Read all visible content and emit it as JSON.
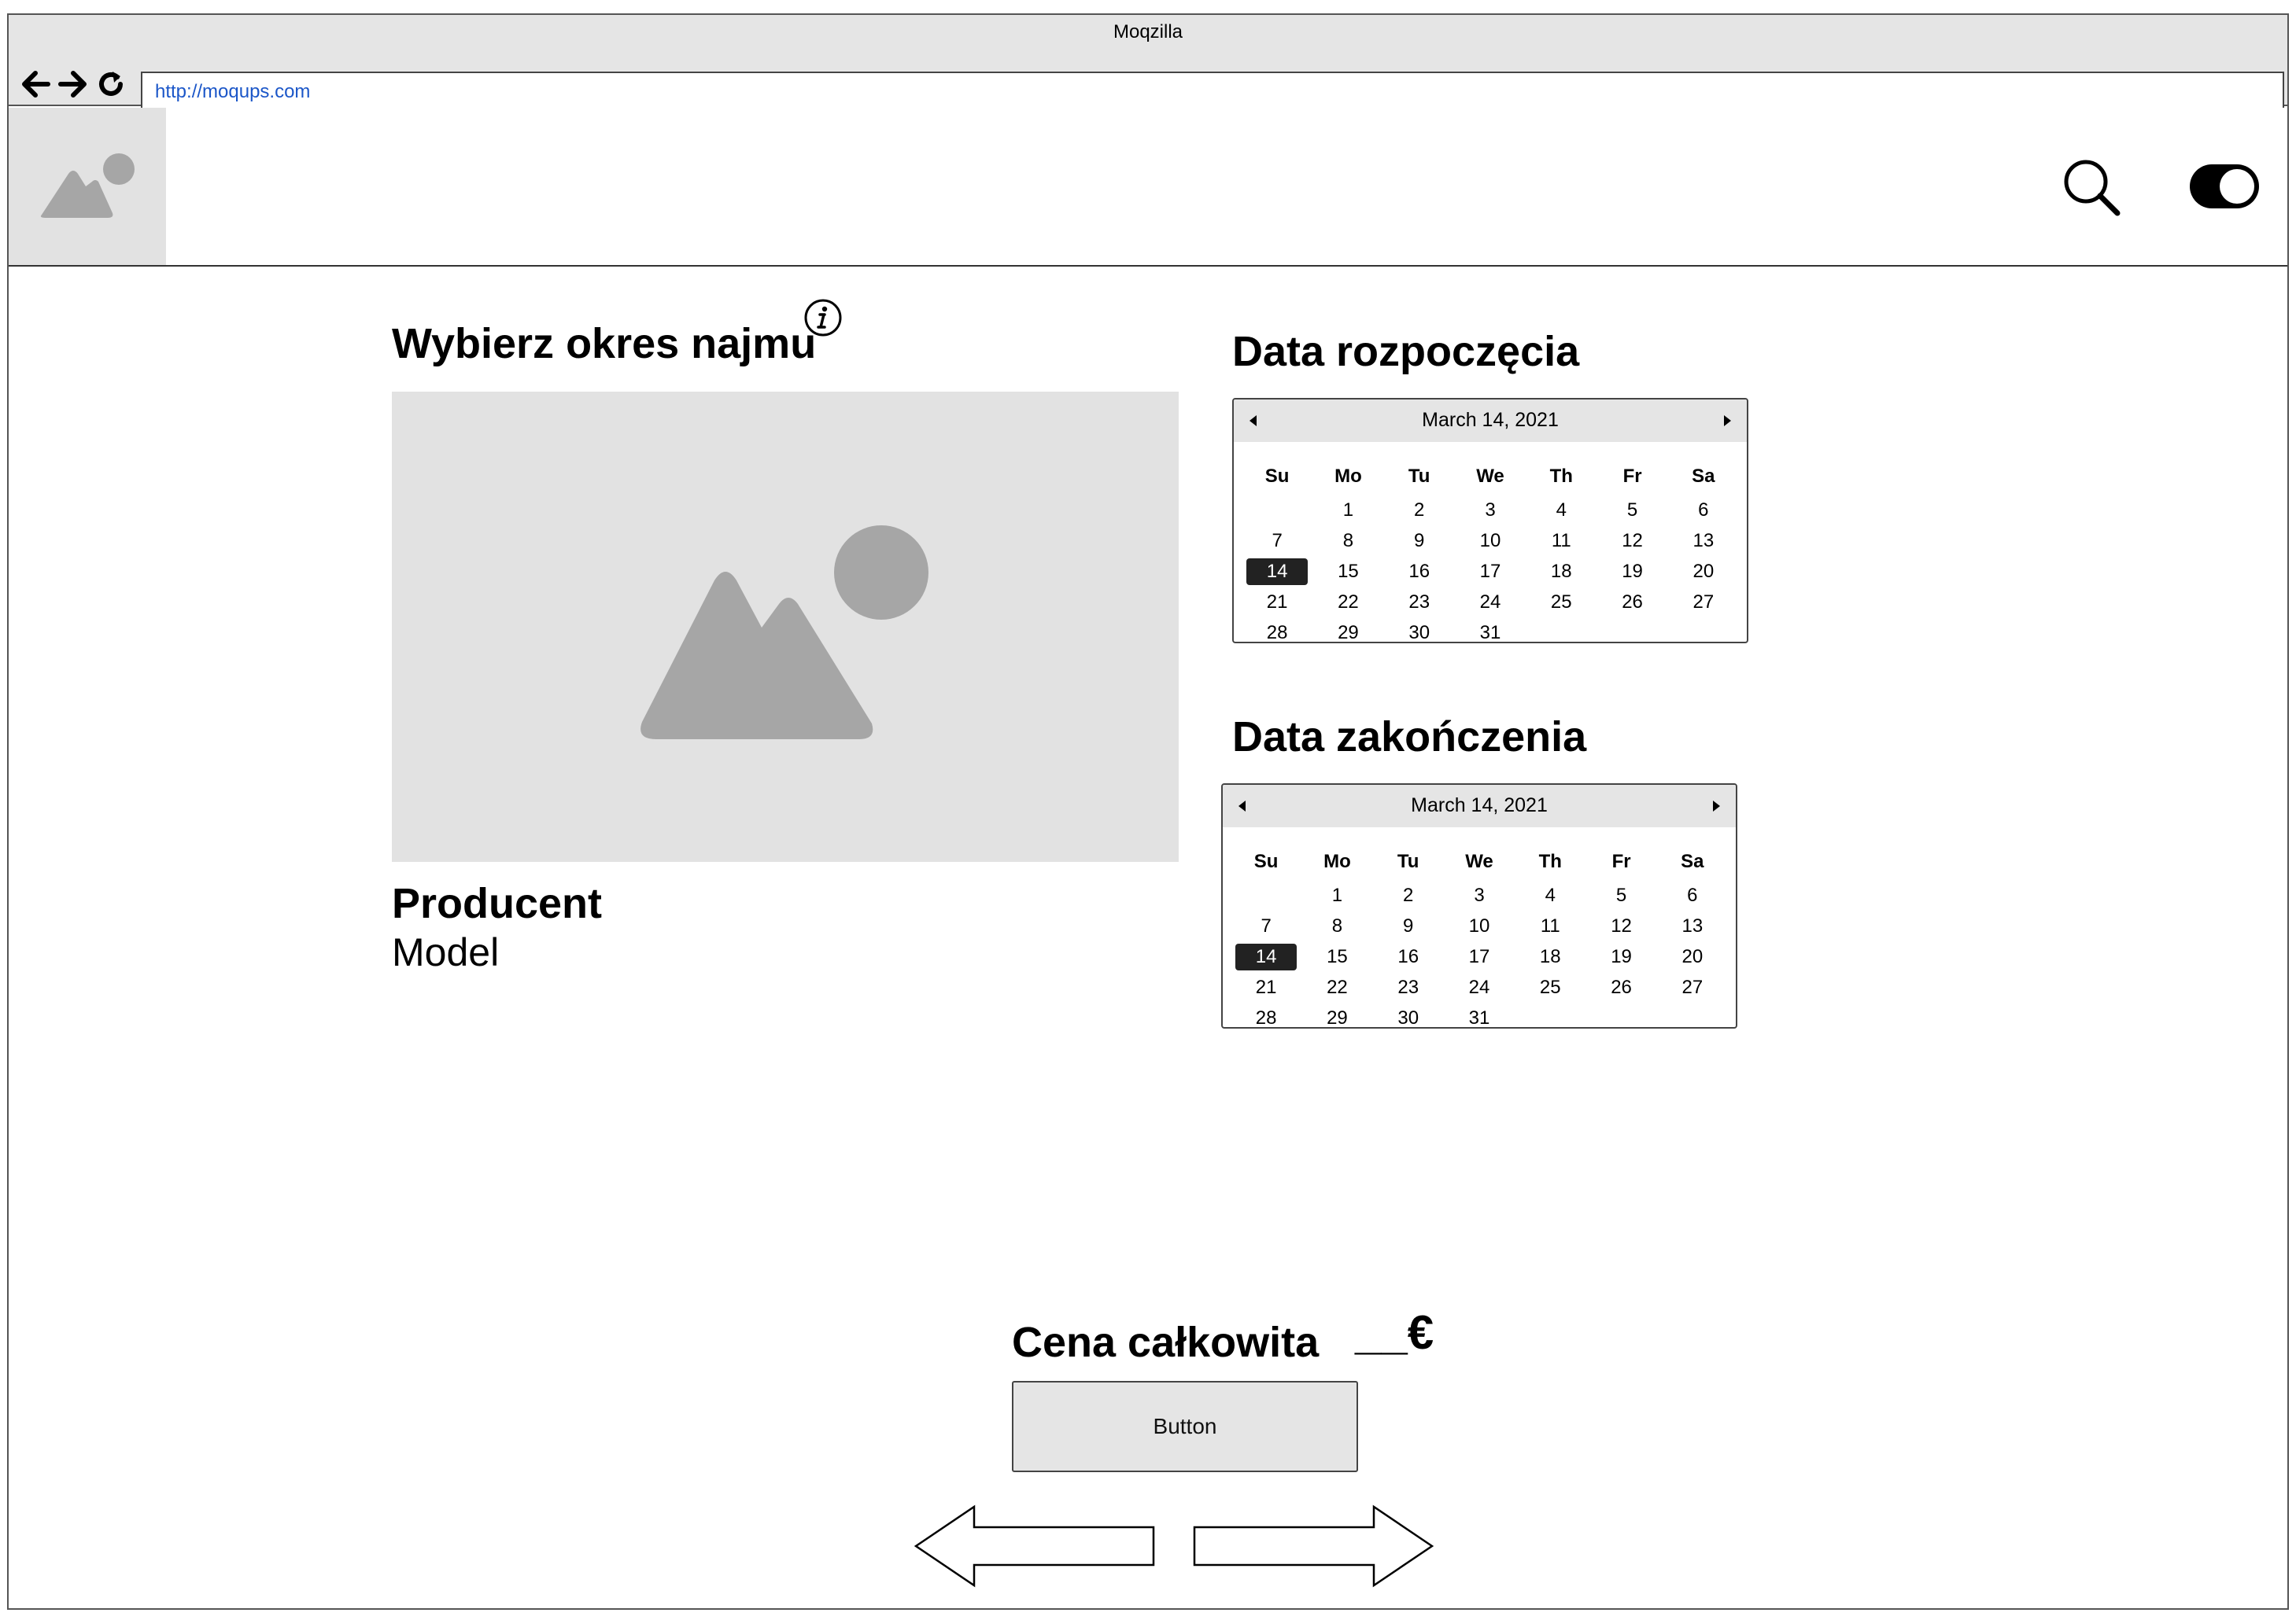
{
  "browser": {
    "title": "Moqzilla",
    "url": "http://moqups.com"
  },
  "header": {
    "logo_icon": "image-placeholder-icon",
    "search_icon": "search-icon",
    "toggle_icon": "toggle-switch-icon",
    "toggle_on": true
  },
  "rental": {
    "heading": "Wybierz okres najmu",
    "info_icon": "info-icon",
    "image_icon": "image-placeholder-icon",
    "producer": "Producent",
    "model": "Model"
  },
  "start_date": {
    "heading": "Data rozpoczęcia",
    "month_label": "March 14, 2021",
    "weekdays": [
      "Su",
      "Mo",
      "Tu",
      "We",
      "Th",
      "Fr",
      "Sa"
    ],
    "days": [
      "",
      "1",
      "2",
      "3",
      "4",
      "5",
      "6",
      "7",
      "8",
      "9",
      "10",
      "11",
      "12",
      "13",
      "14",
      "15",
      "16",
      "17",
      "18",
      "19",
      "20",
      "21",
      "22",
      "23",
      "24",
      "25",
      "26",
      "27",
      "28",
      "29",
      "30",
      "31"
    ],
    "selected": "14"
  },
  "end_date": {
    "heading": "Data zakończenia",
    "month_label": "March 14, 2021",
    "weekdays": [
      "Su",
      "Mo",
      "Tu",
      "We",
      "Th",
      "Fr",
      "Sa"
    ],
    "days": [
      "",
      "1",
      "2",
      "3",
      "4",
      "5",
      "6",
      "7",
      "8",
      "9",
      "10",
      "11",
      "12",
      "13",
      "14",
      "15",
      "16",
      "17",
      "18",
      "19",
      "20",
      "21",
      "22",
      "23",
      "24",
      "25",
      "26",
      "27",
      "28",
      "29",
      "30",
      "31"
    ],
    "selected": "14"
  },
  "price": {
    "label": "Cena całkowita",
    "value": "__€",
    "button": "Button"
  },
  "pager": {
    "prev_icon": "arrow-left-icon",
    "next_icon": "arrow-right-icon"
  },
  "colors": {
    "chrome": "#e5e5e5",
    "placeholder": "#e2e2e2",
    "placeholder_icon": "#a6a6a6",
    "link": "#1b56c8",
    "selected_day": "#222222"
  }
}
